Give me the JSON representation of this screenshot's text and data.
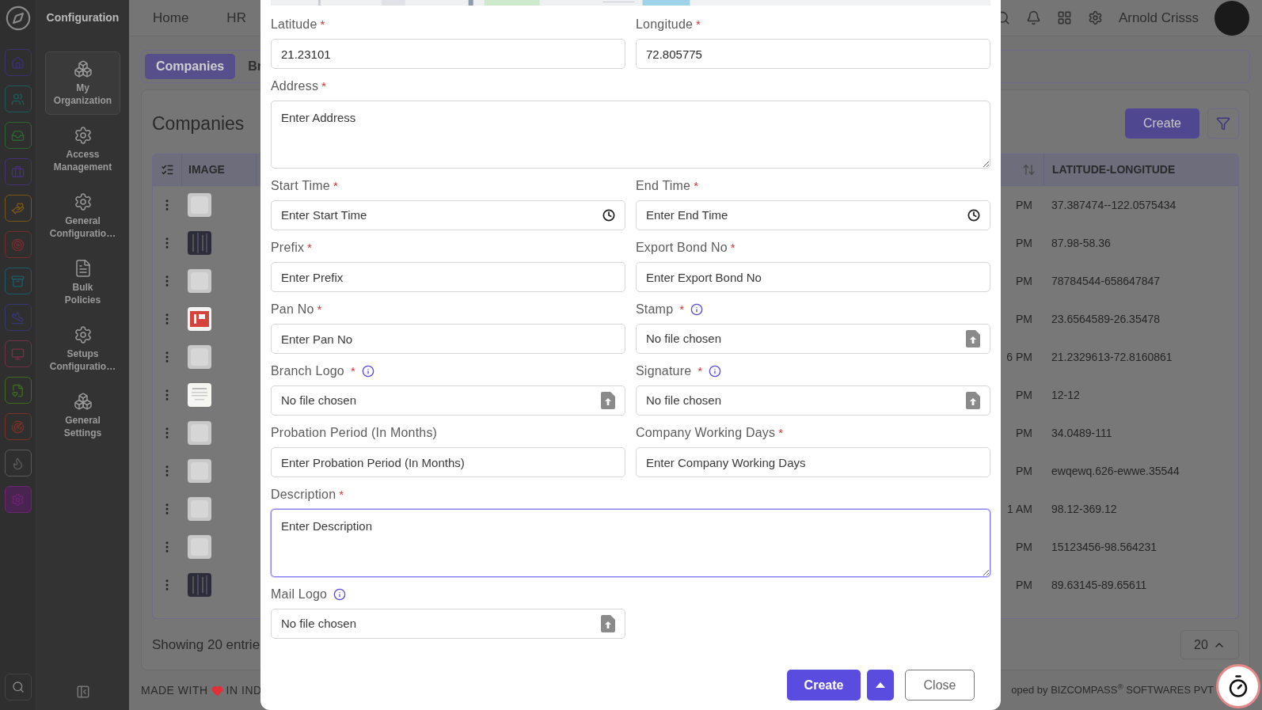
{
  "rail": {
    "items": [
      {
        "color": "#3b3273",
        "selected": false
      },
      {
        "color": "#1a5c57",
        "selected": false
      },
      {
        "color": "#2b6631",
        "selected": false
      },
      {
        "color": "#45307a",
        "selected": false
      },
      {
        "color": "#7a5518",
        "selected": false
      },
      {
        "color": "#772b30",
        "selected": false
      },
      {
        "color": "#1b5c69",
        "selected": false
      },
      {
        "color": "#383576",
        "selected": false
      },
      {
        "color": "#753045",
        "selected": false
      },
      {
        "color": "#3f6a1e",
        "selected": false
      },
      {
        "color": "#7a3128",
        "selected": false
      },
      {
        "color": "#5a5a5a",
        "selected": false
      },
      {
        "color": "#6c2570",
        "selected": true
      }
    ]
  },
  "submenu": {
    "title": "Configuration",
    "items": [
      {
        "label": "My Organization",
        "selected": true
      },
      {
        "label": "Access Management",
        "selected": false
      },
      {
        "label": "General Configuratio…",
        "selected": false
      },
      {
        "label": "Bulk Policies",
        "selected": false
      },
      {
        "label": "Setups Configuratio…",
        "selected": false
      },
      {
        "label": "General Settings",
        "selected": false
      }
    ]
  },
  "header": {
    "nav": [
      "Home",
      "HR"
    ],
    "user": "Arnold Crisss"
  },
  "tabs": [
    {
      "label": "Companies",
      "selected": true
    },
    {
      "label": "Br",
      "selected": false
    }
  ],
  "page": {
    "title": "Companies",
    "create": "Create",
    "columns": {
      "image": "IMAGE",
      "lat_long": "LATITUDE-LONGITUDE"
    },
    "rows": [
      {
        "column_5": "PM",
        "lat_long": "37.387474--122.0575434"
      },
      {
        "column_5": "PM",
        "lat_long": "87.98-58.36"
      },
      {
        "column_5": "PM",
        "lat_long": "78784544-658647847"
      },
      {
        "column_5": "PM",
        "lat_long": "23.6564589-26.35478"
      },
      {
        "column_5": "6 PM",
        "lat_long": "21.2329613-72.8160861"
      },
      {
        "column_5": "PM",
        "lat_long": "12-12"
      },
      {
        "column_5": "PM",
        "lat_long": "34.0489-111"
      },
      {
        "column_5": "PM",
        "lat_long": "ewqewq.626-ewwe.35544"
      },
      {
        "column_5": "1 AM",
        "lat_long": "98.12-369.12"
      },
      {
        "column_5": "PM",
        "lat_long": "15123456-98.564231"
      },
      {
        "column_5": "PM",
        "lat_long": "89.63145-89.65611"
      }
    ],
    "showing": "Showing 20 entrie",
    "page_size": "20"
  },
  "footer": {
    "left_1": "MADE WITH",
    "left_2": "IN IND",
    "right": "oped by BIZCOMPASS$^{®}$ SOFTWARES PVT"
  },
  "dialog": {
    "fields": [
      {
        "kind": "text",
        "label": "Latitude",
        "required_mark": "*",
        "value": "21.23101"
      },
      {
        "kind": "text",
        "label": "Longitude",
        "required_mark": "*",
        "value": "72.805775"
      },
      {
        "kind": "textarea",
        "label": "Address",
        "required_mark": "*",
        "placeholder": "Enter Address",
        "focused": false
      },
      {
        "kind": "time",
        "label": "Start Time",
        "required_mark": "*",
        "placeholder": "Enter Start Time"
      },
      {
        "kind": "time",
        "label": "End Time",
        "required_mark": "*",
        "placeholder": "Enter End Time"
      },
      {
        "kind": "text",
        "label": "Prefix",
        "required_mark": "*",
        "placeholder": "Enter Prefix"
      },
      {
        "kind": "text",
        "label": "Export Bond No",
        "required_mark": "*",
        "placeholder": "Enter Export Bond No"
      },
      {
        "kind": "text",
        "label": "Pan No",
        "required_mark": "*",
        "placeholder": "Enter Pan No"
      },
      {
        "kind": "file",
        "label": "Stamp",
        "required_mark": "*",
        "info": true,
        "file_text": "No file chosen"
      },
      {
        "kind": "file",
        "label": "Branch Logo",
        "required_mark": "*",
        "info": true,
        "file_text": "No file chosen"
      },
      {
        "kind": "file",
        "label": "Signature",
        "required_mark": "*",
        "info": true,
        "file_text": "No file chosen"
      },
      {
        "kind": "text",
        "label": "Probation Period (In Months)",
        "placeholder": "Enter Probation Period (In Months)"
      },
      {
        "kind": "text",
        "label": "Company Working Days",
        "required_mark": "*",
        "placeholder": "Enter Company Working Days"
      },
      {
        "kind": "textarea",
        "label": "Description",
        "required_mark": "*",
        "placeholder": "Enter Description",
        "focused": true
      },
      {
        "kind": "file",
        "label": "Mail Logo",
        "info": true,
        "file_text": "No file chosen"
      }
    ],
    "buttons": {
      "create": "Create",
      "close": "Close"
    }
  }
}
